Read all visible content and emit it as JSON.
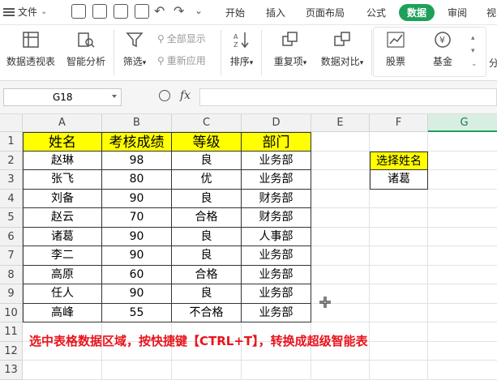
{
  "menu": {
    "file_label": "文件",
    "tabs": [
      "开始",
      "插入",
      "页面布局",
      "公式",
      "数据",
      "审阅",
      "视"
    ],
    "active_tab": "数据"
  },
  "ribbon": {
    "pivot_label": "数据透视表",
    "smart_label": "智能分析",
    "filter_label": "筛选",
    "show_all_label": "全部显示",
    "reapply_label": "重新应用",
    "sort_label": "排序",
    "dup_label": "重复项",
    "compare_label": "数据对比",
    "stock_label": "股票",
    "fund_label": "基金",
    "extra_label": "分"
  },
  "formula_bar": {
    "name_box": "G18",
    "fx_label": "fx",
    "formula": ""
  },
  "sheet": {
    "columns": [
      "A",
      "B",
      "C",
      "D",
      "E",
      "F",
      "G"
    ],
    "selected_column": "G",
    "rows": [
      "1",
      "2",
      "3",
      "4",
      "5",
      "6",
      "7",
      "8",
      "9",
      "10",
      "11",
      "12",
      "13"
    ],
    "table_headers": [
      "姓名",
      "考核成绩",
      "等级",
      "部门"
    ],
    "table_rows": [
      [
        "赵琳",
        "98",
        "良",
        "业务部"
      ],
      [
        "张飞",
        "80",
        "优",
        "业务部"
      ],
      [
        "刘备",
        "90",
        "良",
        "财务部"
      ],
      [
        "赵云",
        "70",
        "合格",
        "财务部"
      ],
      [
        "诸葛",
        "90",
        "良",
        "人事部"
      ],
      [
        "李二",
        "90",
        "良",
        "业务部"
      ],
      [
        "高原",
        "60",
        "合格",
        "业务部"
      ],
      [
        "任人",
        "90",
        "良",
        "业务部"
      ],
      [
        "高峰",
        "55",
        "不合格",
        "业务部"
      ]
    ],
    "lookup_label": "选择姓名",
    "lookup_value": "诸葛",
    "caption": "选中表格数据区域，按快捷键【CTRL+T】，转换成超级智能表"
  },
  "colors": {
    "accent": "#1fa05a",
    "header_fill": "#ffff00",
    "caption": "#e8141d"
  }
}
